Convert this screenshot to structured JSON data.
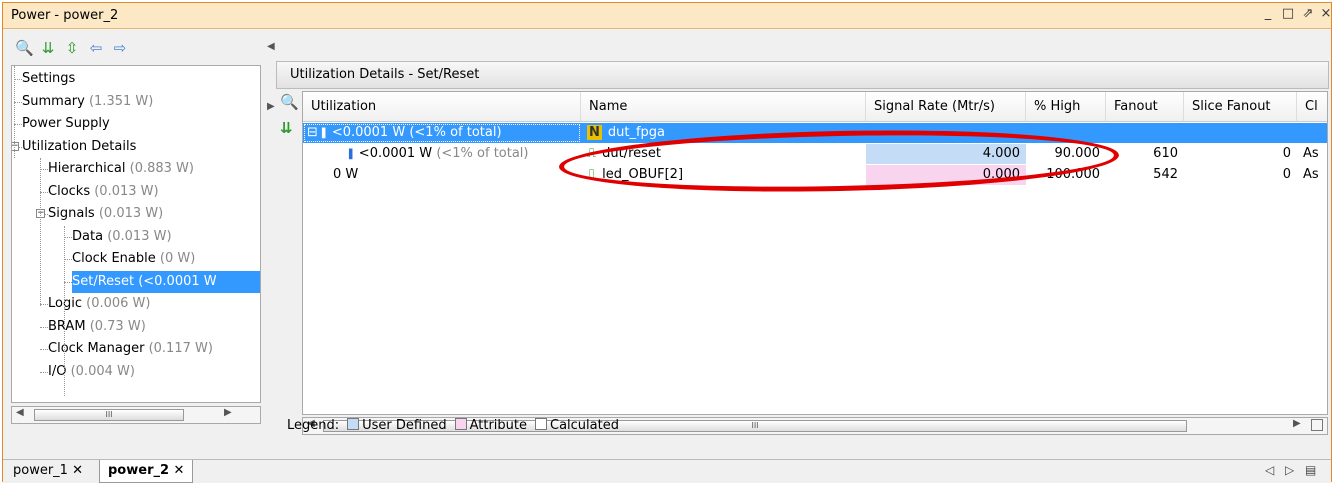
{
  "window": {
    "title": "Power - power_2",
    "controls": [
      "_",
      "□",
      "⇗",
      "×"
    ]
  },
  "left_toolbar": [
    {
      "name": "search-icon",
      "glyph": "🔍",
      "color": "#2a6fdb"
    },
    {
      "name": "collapse-all-icon",
      "glyph": "⇊",
      "color": "#2f9a2f"
    },
    {
      "name": "expand-all-icon",
      "glyph": "⇳",
      "color": "#2f9a2f"
    },
    {
      "name": "back-arrow-icon",
      "glyph": "⇦",
      "color": "#4a7fd4"
    },
    {
      "name": "forward-arrow-icon",
      "glyph": "⇨",
      "color": "#4a7fd4"
    }
  ],
  "tree": [
    {
      "label": "Settings",
      "watt": "",
      "level": 0
    },
    {
      "label": "Summary",
      "watt": "(1.351 W)",
      "level": 0
    },
    {
      "label": "Power Supply",
      "watt": "",
      "level": 0
    },
    {
      "label": "Utilization Details",
      "watt": "",
      "level": 0,
      "expanded": true
    },
    {
      "label": "Hierarchical",
      "watt": "(0.883 W)",
      "level": 1
    },
    {
      "label": "Clocks",
      "watt": "(0.013 W)",
      "level": 1
    },
    {
      "label": "Signals",
      "watt": "(0.013 W)",
      "level": 1,
      "expanded": true
    },
    {
      "label": "Data",
      "watt": "(0.013 W)",
      "level": 2
    },
    {
      "label": "Clock Enable",
      "watt": "(0 W)",
      "level": 2
    },
    {
      "label": "Set/Reset",
      "watt": "(<0.0001 W",
      "level": 2,
      "selected": true
    },
    {
      "label": "Logic",
      "watt": "(0.006 W)",
      "level": 1
    },
    {
      "label": "BRAM",
      "watt": "(0.73 W)",
      "level": 1
    },
    {
      "label": "Clock Manager",
      "watt": "(0.117 W)",
      "level": 1
    },
    {
      "label": "I/O",
      "watt": "(0.004 W)",
      "level": 1
    }
  ],
  "panel": {
    "title": "Utilization Details - Set/Reset"
  },
  "columns": [
    "Utilization",
    "Name",
    "Signal Rate (Mtr/s)",
    "% High",
    "Fanout",
    "Slice Fanout",
    "Cl"
  ],
  "rows": [
    {
      "utilization": "<0.0001 W",
      "util_pct": "(<1% of total)",
      "name": "dut_fpga",
      "rate": "",
      "high": "",
      "fanout": "",
      "slice": "",
      "cl": "",
      "selected": true,
      "icon": "N"
    },
    {
      "utilization": "<0.0001 W",
      "util_pct": "(<1% of total)",
      "name": "dut/reset",
      "rate": "4.000",
      "high": "90.000",
      "fanout": "610",
      "slice": "0",
      "cl": "As",
      "rate_color": "#c4dcf6"
    },
    {
      "utilization": "0 W",
      "util_pct": "",
      "name": "led_OBUF[2]",
      "rate": "0.000",
      "high": "100.000",
      "fanout": "542",
      "slice": "0",
      "cl": "As",
      "rate_color": "#f8d4ee"
    }
  ],
  "legend": {
    "label": "Legend:",
    "items": [
      {
        "text": "User Defined",
        "color": "#c4dcf6"
      },
      {
        "text": "Attribute",
        "color": "#f8d4ee"
      },
      {
        "text": "Calculated",
        "color": "#ffffff"
      }
    ]
  },
  "scroll_mark": "III",
  "tabs": [
    {
      "label": "power_1",
      "active": false
    },
    {
      "label": "power_2",
      "active": true
    }
  ],
  "tab_nav": [
    "◁",
    "▷",
    "▤"
  ]
}
